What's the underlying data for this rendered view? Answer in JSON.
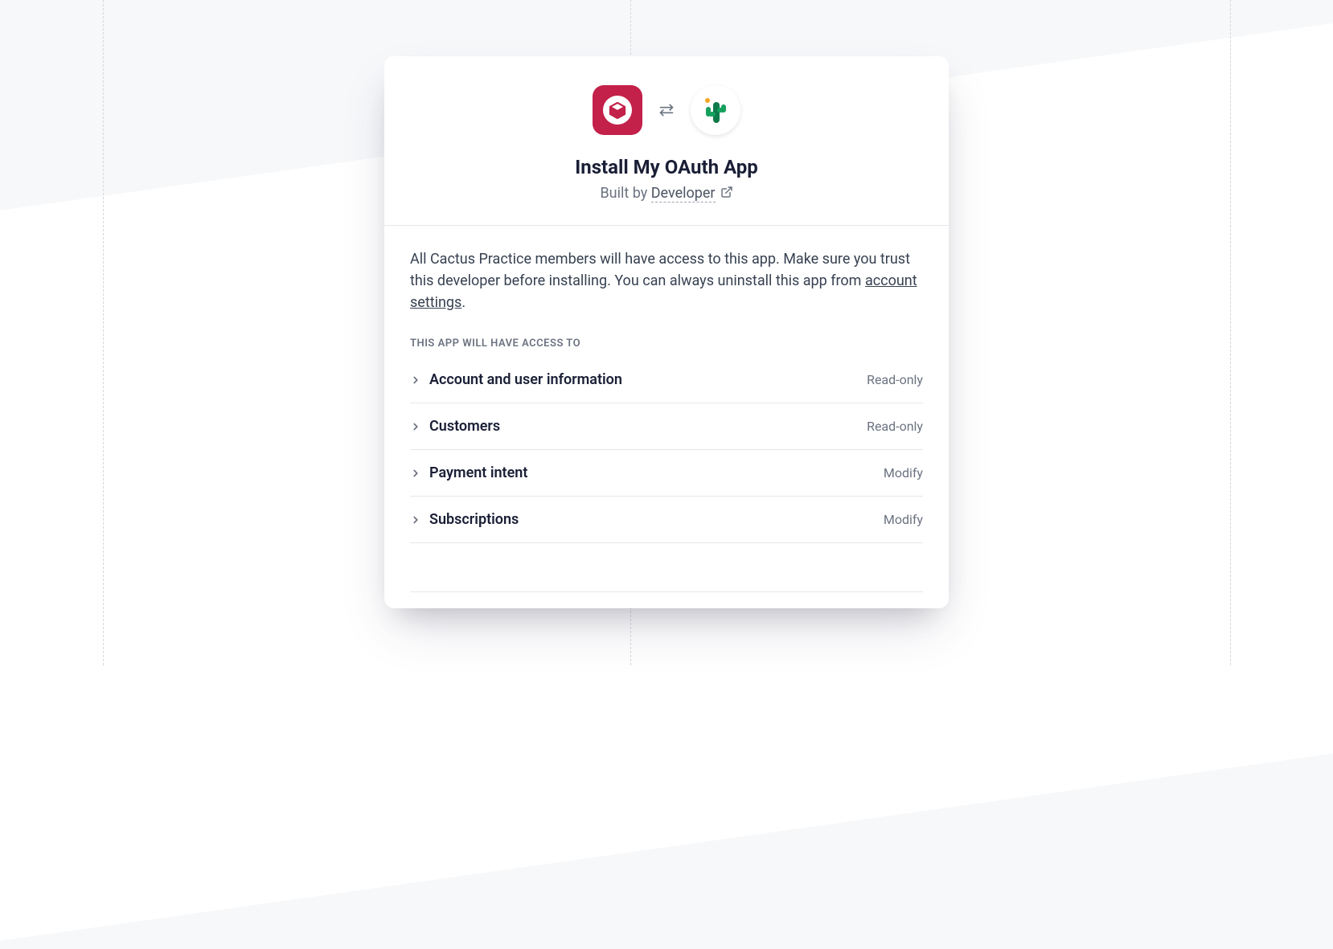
{
  "header": {
    "title": "Install My OAuth App",
    "built_by_prefix": "Built by ",
    "developer_name": "Developer"
  },
  "body": {
    "description_prefix": "All Cactus Practice members will have access to this app. Make sure you trust this developer before installing. You can always uninstall this app from ",
    "settings_link_text": "account settings",
    "description_suffix": ".",
    "access_section_label": "THIS APP WILL HAVE ACCESS TO"
  },
  "permissions": [
    {
      "name": "Account and user information",
      "access": "Read-only"
    },
    {
      "name": "Customers",
      "access": "Read-only"
    },
    {
      "name": "Payment intent",
      "access": "Modify"
    },
    {
      "name": "Subscriptions",
      "access": "Modify"
    }
  ],
  "icons": {
    "app_logo": "box-icon",
    "org_logo": "cactus-icon",
    "swap": "swap-icon",
    "external": "external-link-icon",
    "chevron": "chevron-right-icon"
  }
}
